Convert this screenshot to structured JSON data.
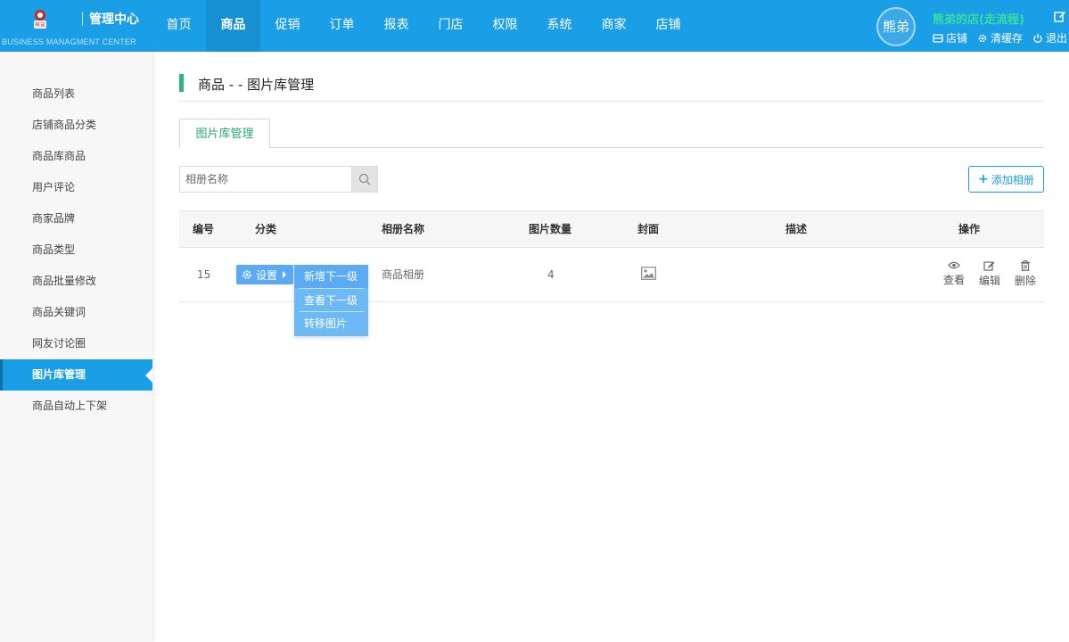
{
  "header": {
    "logo_text": "熊弟",
    "center_title": "管理中心",
    "center_subtitle": "BUSINESS MANAGMENT CENTER",
    "nav": [
      {
        "label": "首页"
      },
      {
        "label": "商品"
      },
      {
        "label": "促销"
      },
      {
        "label": "订单"
      },
      {
        "label": "报表"
      },
      {
        "label": "门店"
      },
      {
        "label": "权限"
      },
      {
        "label": "系统"
      },
      {
        "label": "商家"
      },
      {
        "label": "店铺"
      }
    ],
    "active_nav": "商品",
    "avatar_text": "熊弟",
    "shop_name": "熊弟的店(走流程)",
    "actions": [
      {
        "label": "店铺",
        "icon": "store-icon"
      },
      {
        "label": "清缓存",
        "icon": "gear-icon"
      },
      {
        "label": "退出",
        "icon": "power-icon"
      }
    ]
  },
  "sidebar": {
    "items": [
      {
        "label": "商品列表"
      },
      {
        "label": "店铺商品分类"
      },
      {
        "label": "商品库商品"
      },
      {
        "label": "用户评论"
      },
      {
        "label": "商家品牌"
      },
      {
        "label": "商品类型"
      },
      {
        "label": "商品批量修改"
      },
      {
        "label": "商品关键词"
      },
      {
        "label": "网友讨论圈"
      },
      {
        "label": "图片库管理"
      },
      {
        "label": "商品自动上下架"
      }
    ],
    "active_item": "图片库管理"
  },
  "main": {
    "page_title": "商品 - - 图片库管理",
    "tab_label": "图片库管理",
    "search": {
      "placeholder": "相册名称",
      "value": ""
    },
    "add_button": "添加相册",
    "table": {
      "columns": [
        "编号",
        "分类",
        "相册名称",
        "图片数量",
        "封面",
        "描述",
        "操作"
      ],
      "rows": [
        {
          "id": "15",
          "album_name": "商品相册",
          "count": "4",
          "description": ""
        }
      ]
    },
    "settings_button": "设置",
    "dropdown_items": [
      "新增下一级",
      "查看下一级",
      "转移图片"
    ],
    "row_actions": [
      {
        "label": "查看",
        "icon": "eye-icon"
      },
      {
        "label": "编辑",
        "icon": "edit-icon"
      },
      {
        "label": "删除",
        "icon": "trash-icon"
      }
    ]
  },
  "colors": {
    "primary": "#1a9ee6",
    "accent_green": "#2db37b",
    "shop_name": "#35e0a0",
    "dropdown": "#6db9f5"
  }
}
